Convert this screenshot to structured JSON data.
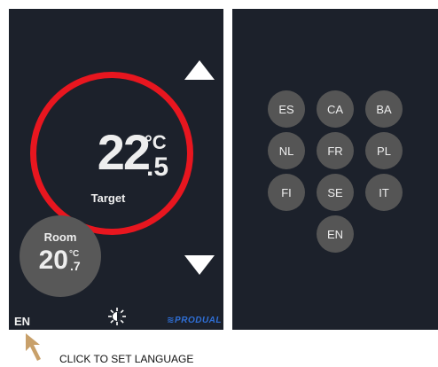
{
  "thermostat": {
    "target": {
      "integer": "22",
      "decimal": ".5",
      "unit": "°C",
      "label": "Target"
    },
    "room": {
      "label": "Room",
      "integer": "20",
      "decimal": ".7",
      "unit": "°C"
    },
    "language_button": "EN",
    "brand": "≋PRODUAL",
    "icons": {
      "up": "triangle-up-icon",
      "down": "triangle-down-icon",
      "sun": "sun-icon"
    },
    "colors": {
      "ring": "#e8161f",
      "panel": "#1c212b",
      "brand": "#2f6fd6",
      "room_circle": "#585858"
    }
  },
  "language_menu": {
    "options": [
      "ES",
      "CA",
      "BA",
      "NL",
      "FR",
      "PL",
      "FI",
      "SE",
      "IT",
      "EN"
    ]
  },
  "annotation": {
    "hint": "CLICK TO SET LANGUAGE",
    "arrow_color": "#c8a06a"
  }
}
